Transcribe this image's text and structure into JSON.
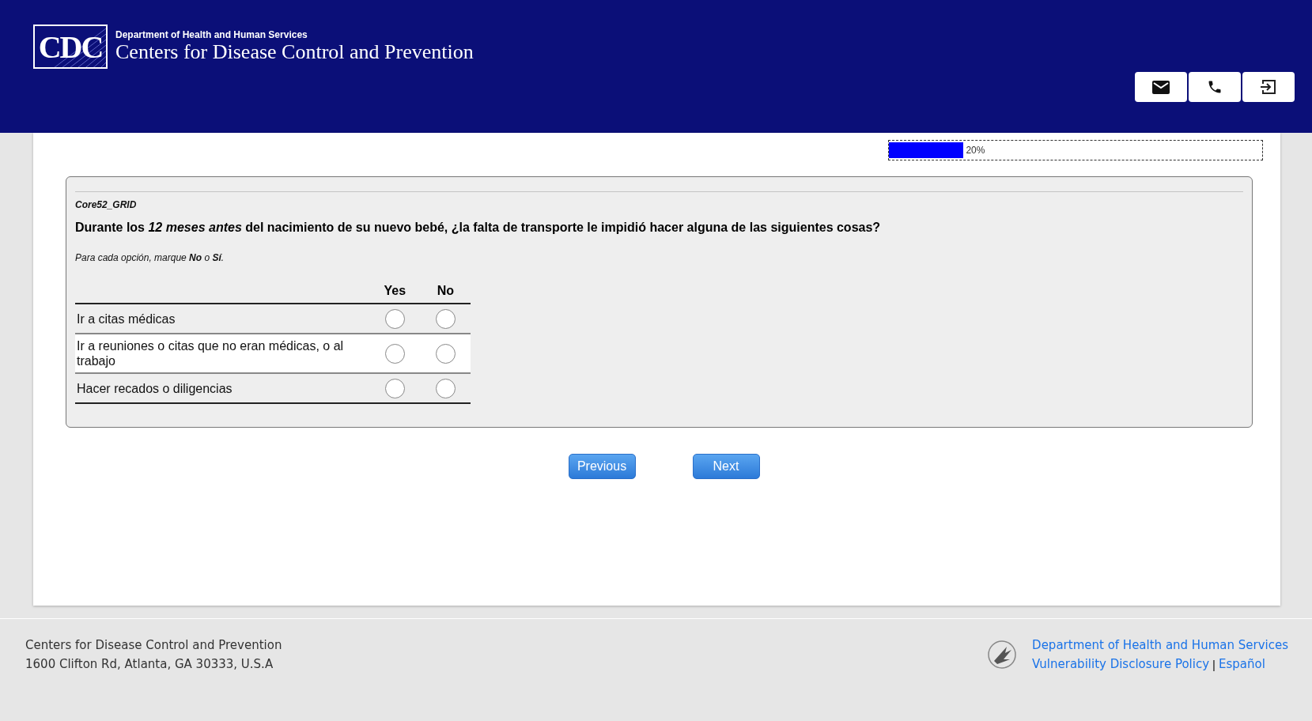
{
  "header": {
    "logo": "CDC",
    "department": "Department of Health and Human Services",
    "title": "Centers for Disease Control and Prevention"
  },
  "progress": {
    "level": 0.2,
    "label": "20%"
  },
  "question": {
    "id": "Core52_GRID",
    "text": "Durante los *12 meses antes* del nacimiento de su nuevo bebé, ¿la falta de transporte le impidió hacer alguna de las siguientes cosas?",
    "instruction": "Para cada opción, marque **No** o **Sí**.",
    "columns": [
      "Yes",
      "No"
    ],
    "rows": [
      {
        "label": "Ir a citas médicas",
        "options": [
          {
            "selected": false
          },
          {
            "selected": false
          }
        ]
      },
      {
        "label": "Ir a reuniones o citas que no eran médicas, o al trabajo",
        "options": [
          {
            "selected": false
          },
          {
            "selected": false
          }
        ]
      },
      {
        "label": "Hacer recados o diligencias",
        "options": [
          {
            "selected": false
          },
          {
            "selected": false
          }
        ]
      }
    ]
  },
  "buttons": [
    "Previous",
    "Next"
  ],
  "footer": {
    "address": [
      "Centers for Disease Control and Prevention",
      "1600 Clifton Rd, Atlanta, GA 30333, U.S.A"
    ],
    "links": [
      [
        "Department of Health and Human Services"
      ],
      [
        "Vulnerability Disclosure Policy",
        "Español"
      ]
    ],
    "separator": "|"
  }
}
